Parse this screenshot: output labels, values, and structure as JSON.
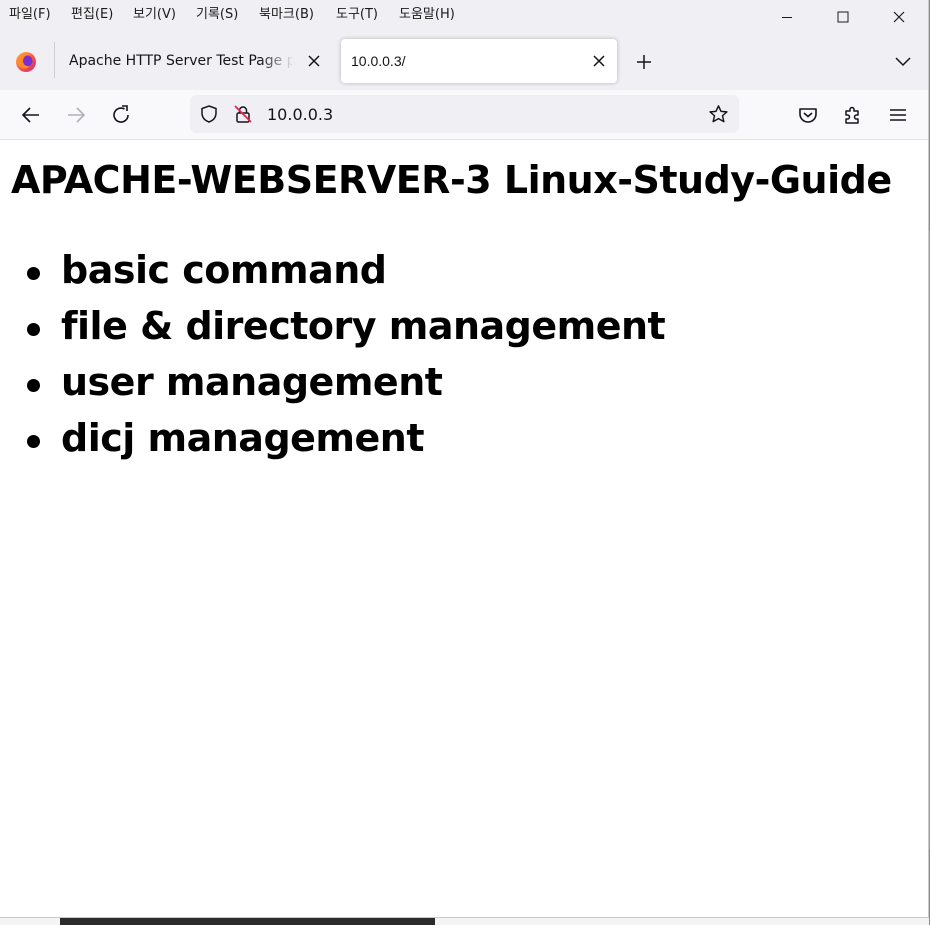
{
  "menu": {
    "items": [
      "파일(F)",
      "편집(E)",
      "보기(V)",
      "기록(S)",
      "북마크(B)",
      "도구(T)",
      "도움말(H)"
    ]
  },
  "tabs": [
    {
      "title": "Apache HTTP Server Test Page powered by CentOS",
      "active": false
    },
    {
      "title": "10.0.0.3/",
      "active": true
    }
  ],
  "navbar": {
    "url": "10.0.0.3"
  },
  "page": {
    "heading": "APACHE-WEBSERVER-3 Linux-Study-Guide",
    "items": [
      "basic command",
      "file & directory management",
      "user management",
      "dicj management"
    ]
  },
  "colors": {
    "chrome": "#f0f0f4",
    "navbar": "#f9f9fb",
    "text": "#000000",
    "insecure_lock": "#e22850"
  }
}
